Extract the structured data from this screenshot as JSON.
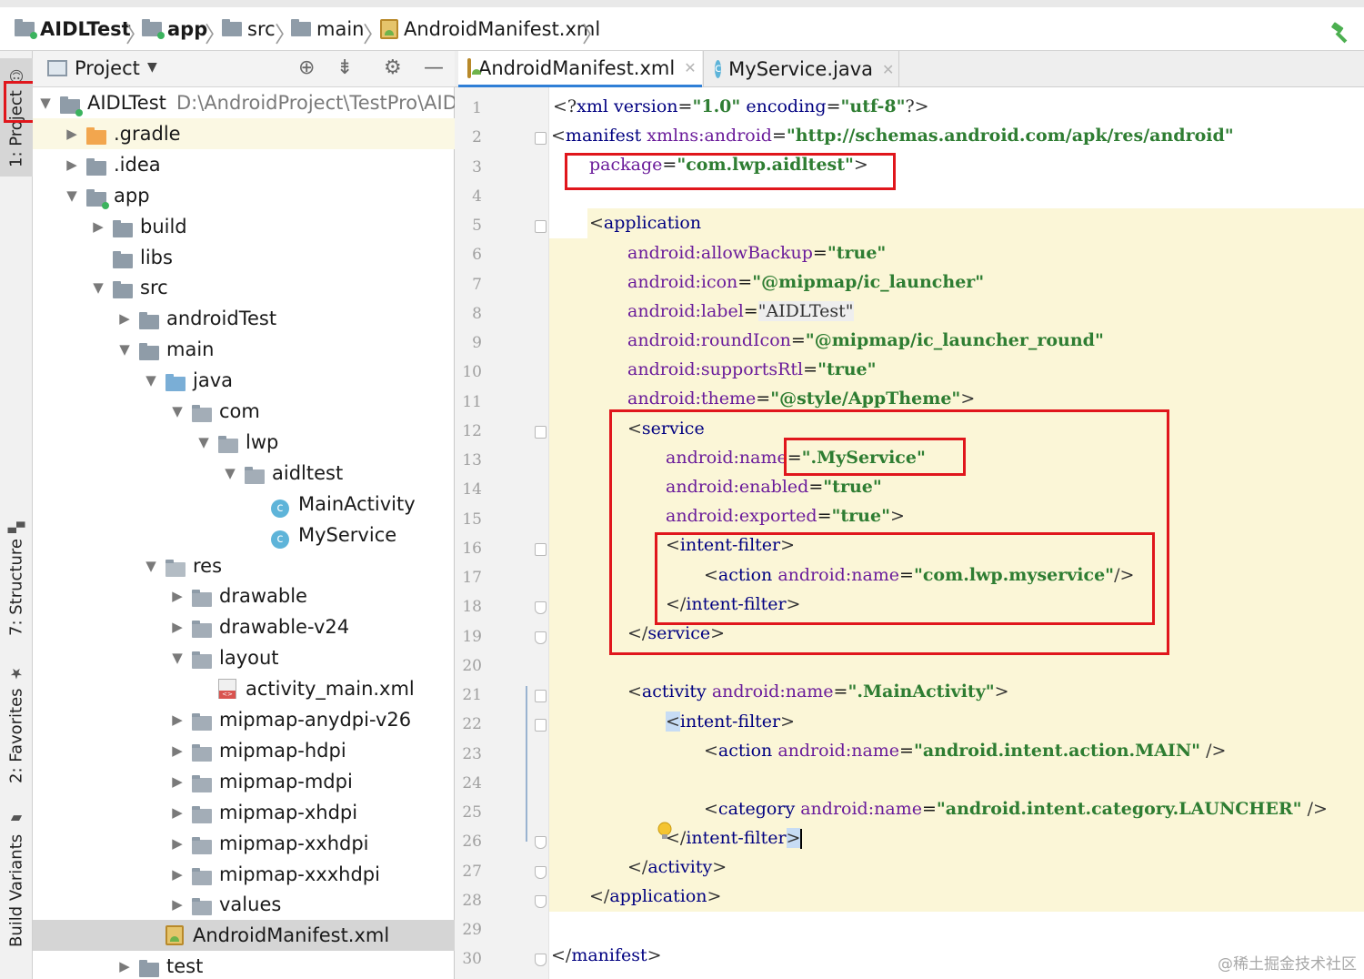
{
  "breadcrumb": [
    {
      "label": "AIDLTest",
      "icon": "module-folder-icon"
    },
    {
      "label": "app",
      "icon": "module-folder-icon"
    },
    {
      "label": "src",
      "icon": "folder-icon"
    },
    {
      "label": "main",
      "icon": "folder-icon"
    },
    {
      "label": "AndroidManifest.xml",
      "icon": "manifest-file-icon"
    }
  ],
  "toolstrip": {
    "project": "1: Project",
    "structure": "7: Structure",
    "favorites": "2: Favorites",
    "build_variants": "Build Variants"
  },
  "project_panel": {
    "title": "Project",
    "tree": [
      {
        "label": "AIDLTest",
        "path": "D:\\AndroidProject\\TestPro\\AIDLT",
        "depth": 0,
        "expanded": true,
        "icon": "module"
      },
      {
        "label": ".gradle",
        "depth": 1,
        "expanded": false,
        "icon": "folder-orange"
      },
      {
        "label": ".idea",
        "depth": 1,
        "expanded": false,
        "icon": "folder"
      },
      {
        "label": "app",
        "depth": 1,
        "expanded": true,
        "icon": "module"
      },
      {
        "label": "build",
        "depth": 2,
        "expanded": false,
        "icon": "folder"
      },
      {
        "label": "libs",
        "depth": 2,
        "icon": "folder"
      },
      {
        "label": "src",
        "depth": 2,
        "expanded": true,
        "icon": "folder"
      },
      {
        "label": "androidTest",
        "depth": 3,
        "expanded": false,
        "icon": "folder"
      },
      {
        "label": "main",
        "depth": 3,
        "expanded": true,
        "icon": "folder"
      },
      {
        "label": "java",
        "depth": 4,
        "expanded": true,
        "icon": "folder-blue"
      },
      {
        "label": "com",
        "depth": 5,
        "expanded": true,
        "icon": "package"
      },
      {
        "label": "lwp",
        "depth": 6,
        "expanded": true,
        "icon": "package"
      },
      {
        "label": "aidltest",
        "depth": 7,
        "expanded": true,
        "icon": "package"
      },
      {
        "label": "MainActivity",
        "depth": 8,
        "icon": "class"
      },
      {
        "label": "MyService",
        "depth": 8,
        "icon": "class"
      },
      {
        "label": "res",
        "depth": 4,
        "expanded": true,
        "icon": "res-folder"
      },
      {
        "label": "drawable",
        "depth": 5,
        "expanded": false,
        "icon": "package"
      },
      {
        "label": "drawable-v24",
        "depth": 5,
        "expanded": false,
        "icon": "package"
      },
      {
        "label": "layout",
        "depth": 5,
        "expanded": true,
        "icon": "package"
      },
      {
        "label": "activity_main.xml",
        "depth": 6,
        "icon": "xml"
      },
      {
        "label": "mipmap-anydpi-v26",
        "depth": 5,
        "expanded": false,
        "icon": "package"
      },
      {
        "label": "mipmap-hdpi",
        "depth": 5,
        "expanded": false,
        "icon": "package"
      },
      {
        "label": "mipmap-mdpi",
        "depth": 5,
        "expanded": false,
        "icon": "package"
      },
      {
        "label": "mipmap-xhdpi",
        "depth": 5,
        "expanded": false,
        "icon": "package"
      },
      {
        "label": "mipmap-xxhdpi",
        "depth": 5,
        "expanded": false,
        "icon": "package"
      },
      {
        "label": "mipmap-xxxhdpi",
        "depth": 5,
        "expanded": false,
        "icon": "package"
      },
      {
        "label": "values",
        "depth": 5,
        "expanded": false,
        "icon": "package"
      },
      {
        "label": "AndroidManifest.xml",
        "depth": 4,
        "icon": "manifest",
        "selected": true
      },
      {
        "label": "test",
        "depth": 3,
        "expanded": false,
        "icon": "folder"
      }
    ]
  },
  "editor": {
    "tabs": [
      {
        "label": "AndroidManifest.xml",
        "icon": "manifest-file-icon",
        "active": true
      },
      {
        "label": "MyService.java",
        "icon": "class-icon",
        "active": false
      }
    ],
    "line_numbers": [
      "1",
      "2",
      "3",
      "4",
      "5",
      "6",
      "7",
      "8",
      "9",
      "10",
      "11",
      "12",
      "13",
      "14",
      "15",
      "16",
      "17",
      "18",
      "19",
      "20",
      "21",
      "22",
      "23",
      "24",
      "25",
      "26",
      "27",
      "28",
      "29",
      "30"
    ],
    "code": {
      "l1_a": "<?",
      "l1_b": "xml version",
      "l1_c": "=",
      "l1_d": "\"1.0\"",
      "l1_e": " encoding",
      "l1_f": "=",
      "l1_g": "\"utf-8\"",
      "l1_h": "?>",
      "l2_a": "<",
      "l2_b": "manifest ",
      "l2_c": "xmlns:android",
      "l2_d": "=",
      "l2_e": "\"http://schemas.android.com/apk/res/android\"",
      "l3_a": "package",
      "l3_b": "=",
      "l3_c": "\"com.lwp.aidltest\"",
      "l3_d": ">",
      "l5_a": "<",
      "l5_b": "application",
      "l6_a": "android:allowBackup",
      "l6_b": "=",
      "l6_c": "\"true\"",
      "l7_a": "android:icon",
      "l7_b": "=",
      "l7_c": "\"@mipmap/ic_launcher\"",
      "l8_a": "android:label",
      "l8_b": "=",
      "l8_c": "\"AIDLTest\"",
      "l9_a": "android:roundIcon",
      "l9_b": "=",
      "l9_c": "\"@mipmap/ic_launcher_round\"",
      "l10_a": "android:supportsRtl",
      "l10_b": "=",
      "l10_c": "\"true\"",
      "l11_a": "android:theme",
      "l11_b": "=",
      "l11_c": "\"@style/AppTheme\"",
      "l11_d": ">",
      "l12_a": "<",
      "l12_b": "service",
      "l13_a": "android:name",
      "l13_b": "=",
      "l13_c": "\".MyService\"",
      "l14_a": "android:enabled",
      "l14_b": "=",
      "l14_c": "\"true\"",
      "l15_a": "android:exported",
      "l15_b": "=",
      "l15_c": "\"true\"",
      "l15_d": ">",
      "l16_a": "<",
      "l16_b": "intent-filter",
      "l16_c": ">",
      "l17_a": "<",
      "l17_b": "action ",
      "l17_c": "android:name",
      "l17_d": "=",
      "l17_e": "\"com.lwp.myservice\"",
      "l17_f": "/>",
      "l18_a": "</",
      "l18_b": "intent-filter",
      "l18_c": ">",
      "l19_a": "</",
      "l19_b": "service",
      "l19_c": ">",
      "l21_a": "<",
      "l21_b": "activity ",
      "l21_c": "android:name",
      "l21_d": "=",
      "l21_e": "\".MainActivity\"",
      "l21_f": ">",
      "l22_a": "<",
      "l22_b": "intent-filter",
      "l22_c": ">",
      "l23_a": "<",
      "l23_b": "action ",
      "l23_c": "android:name",
      "l23_d": "=",
      "l23_e": "\"android.intent.action.MAIN\"",
      "l23_f": " />",
      "l25_a": "<",
      "l25_b": "category ",
      "l25_c": "android:name",
      "l25_d": "=",
      "l25_e": "\"android.intent.category.LAUNCHER\"",
      "l25_f": " />",
      "l26_a": "</",
      "l26_b": "intent-filter",
      "l26_c": ">",
      "l27_a": "</",
      "l27_b": "activity",
      "l27_c": ">",
      "l28_a": "</",
      "l28_b": "application",
      "l28_c": ">",
      "l30_a": "</",
      "l30_b": "manifest",
      "l30_c": ">"
    }
  },
  "watermark": "@稀土掘金技术社区",
  "colors": {
    "tag": "#000080",
    "attribute": "#6a1b9a",
    "string": "#2e7d32",
    "highlight_box": "#e0161c",
    "scope_highlight": "#fbf6d7",
    "selection": "#d5d5d5"
  }
}
